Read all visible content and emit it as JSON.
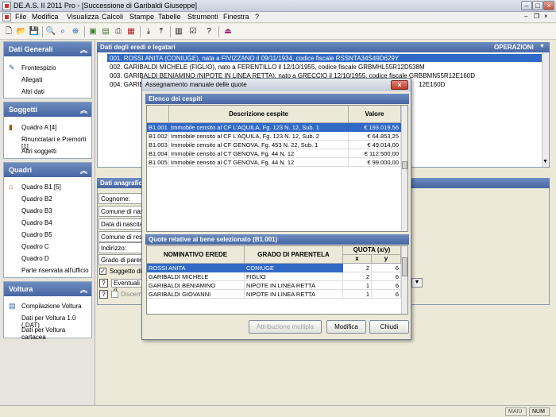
{
  "window": {
    "title": "DE.A.S. II 2011 Pro - [Successione di Garibaldi Giuseppe]"
  },
  "menu": [
    "File",
    "Modifica",
    "Visualizza",
    "Calcoli",
    "Stampe",
    "Tabelle",
    "Strumenti",
    "Finestra",
    "?"
  ],
  "left": {
    "sections": [
      {
        "title": "Dati Generali",
        "items": [
          "Frontespizio",
          "Allegati",
          "Altri dati"
        ]
      },
      {
        "title": "Soggetti",
        "items": [
          "Quadro A [4]",
          "Rinunciatari e Premorti [1]",
          "Altri soggetti"
        ]
      },
      {
        "title": "Quadri",
        "items": [
          "Quadro B1 [5]",
          "Quadro B2",
          "Quadro B3",
          "Quadro B4",
          "Quadro B5",
          "Quadro C",
          "Quadro D",
          "Parte riservata all'ufficio"
        ]
      },
      {
        "title": "Voltura",
        "items": [
          "Compilazione Voltura",
          "Dati per Voltura 1.0 (.DAT)",
          "Dati per Voltura cartacea"
        ]
      }
    ]
  },
  "main": {
    "heirs_header": "Dati degli eredi e legatari",
    "operations_label": "OPERAZIONI",
    "heirs": [
      "001. ROSSI ANITA (CONIUGE), nata a FIVIZZANO il 09/11/1934, codice fiscale RSSNTA34S49D629Y",
      "002. GARIBALDI MICHELE (FIGLIO), nato a FERENTILLO il 12/10/1955, codice fiscale GRBMHL55R12D538M",
      "003. GARIBALDI BENIAMINO (NIPOTE IN LINEA RETTA), nato a GRECCIO il 12/10/1955, codice fiscale GRBBMN55R12E160D",
      "004. GARIBALDI",
      "12E160D"
    ],
    "anag_header": "Dati anagrafici",
    "anag_fields": [
      "Cognome:",
      "Comune di nascita",
      "Data di nascita",
      "Comune di residenza",
      "Indirizzo:",
      "Grado di parentela"
    ],
    "soggetto_label": "Soggetto di",
    "eventuali_label": "Eventuali ri",
    "discerni_label": "Discerni"
  },
  "status": {
    "maiu": "MAIU",
    "num": "NUM"
  },
  "dialog": {
    "title": "Assegnamento manuale delle quote",
    "cespiti_header": "Elenco dei cespiti",
    "cespiti_cols": [
      "Descrizione cespite",
      "Valore"
    ],
    "cespiti": [
      {
        "code": "B1.001",
        "desc": "Immobile censito al CF L'AQUILA, Fg. 123 N. 12, Sub. 1",
        "value": "€ 193.019,56"
      },
      {
        "code": "B1.002",
        "desc": "Immobile censito al CF L'AQUILA, Fg. 123 N. 12, Sub. 2",
        "value": "€ 64.853,25"
      },
      {
        "code": "B1.003",
        "desc": "Immobile censito al CF GENOVA, Fg. 453 N. 22, Sub. 1",
        "value": "€ 49.014,00"
      },
      {
        "code": "B1.004",
        "desc": "Immobile censito al CT GENOVA, Fg. 44 N. 12",
        "value": "€ 112.500,00"
      },
      {
        "code": "B1.005",
        "desc": "Immobile censito al CT GENOVA, Fg. 44 N. 12",
        "value": "€ 99.000,00"
      }
    ],
    "quote_header": "Quote relative al bene selezionato (B1.001)",
    "quote_cols": {
      "erede": "NOMINATIVO EREDE",
      "grado": "GRADO DI PARENTELA",
      "quota": "QUOTA (x/y)",
      "x": "x",
      "y": "y"
    },
    "quote": [
      {
        "erede": "ROSSI ANITA",
        "grado": "CONIUGE",
        "x": "2",
        "y": "6"
      },
      {
        "erede": "GARIBALDI MICHELE",
        "grado": "FIGLIO",
        "x": "2",
        "y": "6"
      },
      {
        "erede": "GARIBALDI BENIAMINO",
        "grado": "NIPOTE IN LINEA RETTA",
        "x": "1",
        "y": "6"
      },
      {
        "erede": "GARIBALDI GIOVANNI",
        "grado": "NIPOTE IN LINEA RETTA",
        "x": "1",
        "y": "6"
      }
    ],
    "buttons": {
      "multipla": "Attribuzione multipla",
      "modifica": "Modifica",
      "chiudi": "Chiudi"
    }
  }
}
